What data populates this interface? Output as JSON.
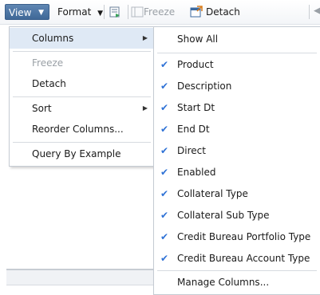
{
  "toolbar": {
    "view_label": "View",
    "format_label": "Format",
    "freeze_label": "Freeze",
    "detach_label": "Detach"
  },
  "view_menu": {
    "items": [
      {
        "label": "Columns",
        "has_submenu": true,
        "active": true
      },
      {
        "label": "Freeze",
        "disabled": true
      },
      {
        "label": "Detach"
      },
      {
        "label": "Sort",
        "has_submenu": true
      },
      {
        "label": "Reorder Columns..."
      },
      {
        "label": "Query By Example"
      }
    ]
  },
  "columns_menu": {
    "show_all": "Show All",
    "columns": [
      {
        "label": "Product",
        "checked": true
      },
      {
        "label": "Description",
        "checked": true
      },
      {
        "label": "Start Dt",
        "checked": true
      },
      {
        "label": "End Dt",
        "checked": true
      },
      {
        "label": "Direct",
        "checked": true
      },
      {
        "label": "Enabled",
        "checked": true
      },
      {
        "label": "Collateral Type",
        "checked": true
      },
      {
        "label": "Collateral Sub Type",
        "checked": true
      },
      {
        "label": "Credit Bureau Portfolio Type",
        "checked": true
      },
      {
        "label": "Credit Bureau Account Type",
        "checked": true
      }
    ],
    "manage": "Manage Columns..."
  },
  "colors": {
    "accent": "#3f6897",
    "check": "#2f72d6",
    "active_row": "#dfe9f5"
  }
}
